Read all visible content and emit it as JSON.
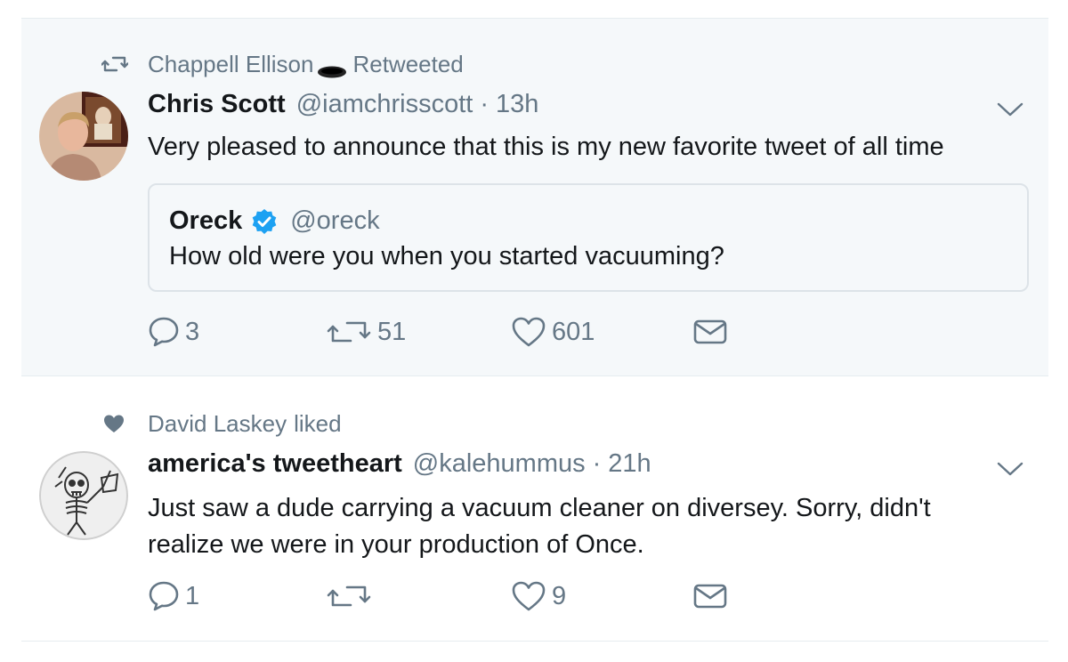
{
  "colors": {
    "background_highlight": "#f5f8fa",
    "secondary_text": "#657786",
    "primary_text": "#14171a",
    "verified_blue": "#1da1f2"
  },
  "tweets": [
    {
      "context": {
        "icon": "retweet-icon",
        "actor": "Chappell Ellison",
        "actor_emoji": "hole-emoji",
        "action": "Retweeted"
      },
      "author": {
        "name": "Chris Scott",
        "handle": "@iamchrisscott",
        "separator": "·",
        "time": "13h"
      },
      "text": "Very pleased to announce that this is my new favorite tweet of all time",
      "quote": {
        "name": "Oreck",
        "verified": true,
        "handle": "@oreck",
        "text": "How old were you when you started vacuuming?"
      },
      "actions": {
        "replies": "3",
        "retweets": "51",
        "likes": "601"
      }
    },
    {
      "context": {
        "icon": "heart-filled-icon",
        "actor": "David Laskey",
        "action": "liked"
      },
      "author": {
        "name": "america's tweetheart",
        "handle": "@kalehummus",
        "separator": "·",
        "time": "21h"
      },
      "text_lines": [
        "Just saw a dude carrying a vacuum cleaner on diversey. Sorry, didn't",
        "realize we were in your production of Once."
      ],
      "actions": {
        "replies": "1",
        "retweets": "",
        "likes": "9"
      }
    }
  ]
}
